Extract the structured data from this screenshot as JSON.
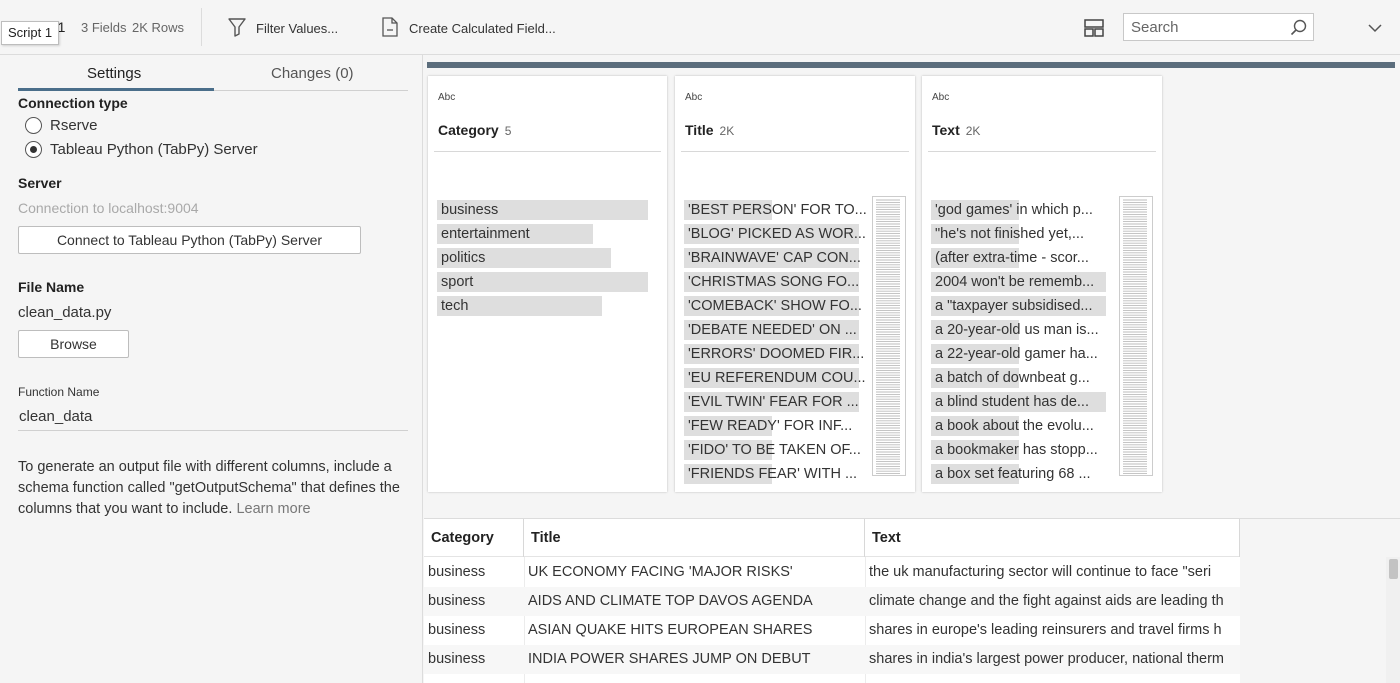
{
  "toolbar": {
    "script_name": "Script 1",
    "fields": "3 Fields",
    "rows": "2K Rows",
    "filter_label": "Filter Values...",
    "calc_label": "Create Calculated Field...",
    "search_placeholder": "Search"
  },
  "tabs": {
    "settings": "Settings",
    "changes": "Changes (0)"
  },
  "settings": {
    "connection_type_label": "Connection type",
    "options": [
      {
        "label": "Rserve",
        "checked": false
      },
      {
        "label": "Tableau Python (TabPy) Server",
        "checked": true
      }
    ],
    "server_label": "Server",
    "server_status": "Connection to localhost:9004",
    "connect_button": "Connect to Tableau Python (TabPy) Server",
    "file_name_label": "File Name",
    "file_name": "clean_data.py",
    "browse_button": "Browse",
    "function_name_label": "Function Name",
    "function_name": "clean_data",
    "help_text": "To generate an output file with different columns, include a schema function called \"getOutputSchema\" that defines the columns that you want to include.",
    "learn_more": "Learn more"
  },
  "profile_cards": [
    {
      "type": "Abc",
      "name": "Category",
      "count": "5",
      "values": [
        {
          "text": "business",
          "share": 0.23
        },
        {
          "text": "entertainment",
          "share": 0.17
        },
        {
          "text": "politics",
          "share": 0.19
        },
        {
          "text": "sport",
          "share": 0.23
        },
        {
          "text": "tech",
          "share": 0.18
        }
      ]
    },
    {
      "type": "Abc",
      "name": "Title",
      "count": "2K",
      "values": [
        {
          "text": "'BEST PERSON' FOR TO...",
          "share": 0.5
        },
        {
          "text": "'BLOG' PICKED AS WOR...",
          "share": 1
        },
        {
          "text": "'BRAINWAVE' CAP CON...",
          "share": 1
        },
        {
          "text": "'CHRISTMAS SONG FO...",
          "share": 1
        },
        {
          "text": "'COMEBACK' SHOW FO...",
          "share": 1
        },
        {
          "text": "'DEBATE NEEDED' ON ...",
          "share": 1
        },
        {
          "text": "'ERRORS' DOOMED FIR...",
          "share": 1
        },
        {
          "text": "'EU REFERENDUM COU...",
          "share": 1
        },
        {
          "text": "'EVIL TWIN' FEAR FOR ...",
          "share": 1
        },
        {
          "text": "'FEW READY' FOR INF...",
          "share": 0.5
        },
        {
          "text": "'FIDO' TO BE TAKEN OF...",
          "share": 0.5
        },
        {
          "text": "'FRIENDS FEAR' WITH ...",
          "share": 0.5
        }
      ]
    },
    {
      "type": "Abc",
      "name": "Text",
      "count": "2K",
      "values": [
        {
          "text": "'god games' in which p...",
          "share": 0.5
        },
        {
          "text": "\"he's not finished yet,...",
          "share": 0.5
        },
        {
          "text": "(after extra-time - scor...",
          "share": 0.5
        },
        {
          "text": "2004 won't be rememb...",
          "share": 1
        },
        {
          "text": "a \"taxpayer subsidised...",
          "share": 1
        },
        {
          "text": "a 20-year-old us man is...",
          "share": 0.5
        },
        {
          "text": "a 22-year-old gamer ha...",
          "share": 0.5
        },
        {
          "text": "a batch of downbeat g...",
          "share": 0.5
        },
        {
          "text": "a blind student has de...",
          "share": 1
        },
        {
          "text": "a book about the evolu...",
          "share": 0.5
        },
        {
          "text": "a bookmaker has stopp...",
          "share": 0.5
        },
        {
          "text": "a box set featuring 68 ...",
          "share": 0.5
        }
      ]
    }
  ],
  "grid": {
    "columns": [
      "Category",
      "Title",
      "Text"
    ],
    "rows": [
      [
        "business",
        "UK ECONOMY FACING 'MAJOR RISKS'",
        "the uk manufacturing sector will continue to face \"seri"
      ],
      [
        "business",
        "AIDS AND CLIMATE TOP DAVOS AGENDA",
        "climate change and the fight against aids are leading th"
      ],
      [
        "business",
        "ASIAN QUAKE HITS EUROPEAN SHARES",
        "shares in europe's leading reinsurers and travel firms h"
      ],
      [
        "business",
        "INDIA POWER SHARES JUMP ON DEBUT",
        "shares in india's largest power producer, national therm"
      ]
    ]
  }
}
